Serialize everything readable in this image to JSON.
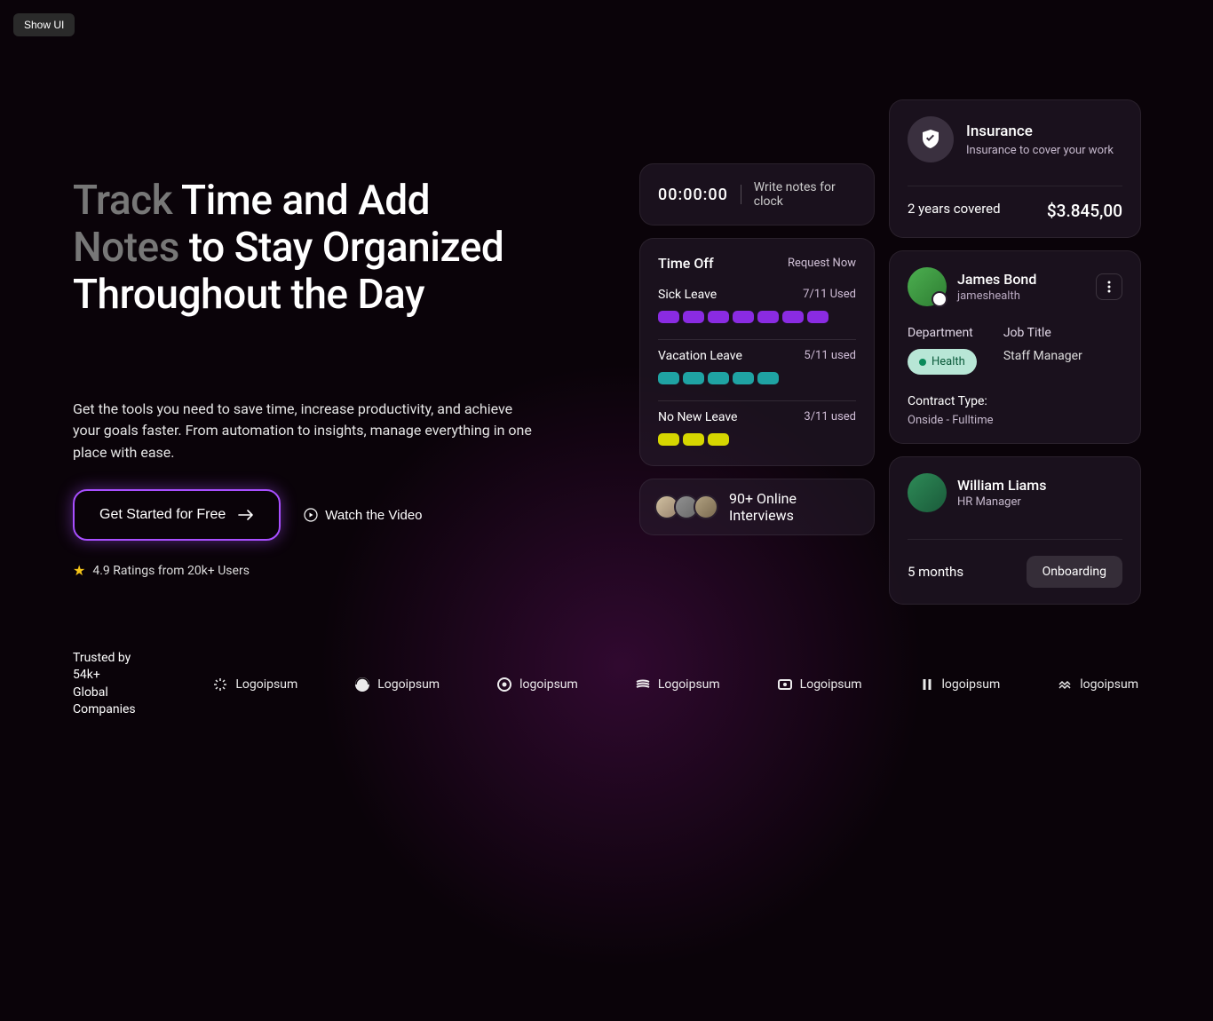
{
  "showUiLabel": "Show UI",
  "hero": {
    "titleDim1": "Track",
    "titlePart1": "Time and Add",
    "titleDim2": "Notes",
    "titlePart2": "to Stay Organized Throughout the Day",
    "subtitle": "Get the tools you need to save time, increase productivity, and achieve your goals faster. From automation to insights, manage everything in one place with ease.",
    "ctaPrimary": "Get Started for Free",
    "ctaSecondary": "Watch the Video",
    "rating": "4.9 Ratings from 20k+ Users"
  },
  "clock": {
    "time": "00:00:00",
    "placeholder": "Write notes for clock"
  },
  "timeoff": {
    "title": "Time Off",
    "request": "Request Now",
    "items": [
      {
        "label": "Sick Leave",
        "used": "7/11 Used",
        "fill": 7,
        "total": 7,
        "color": "purple"
      },
      {
        "label": "Vacation Leave",
        "used": "5/11 used",
        "fill": 5,
        "total": 5,
        "color": "teal"
      },
      {
        "label": "No New Leave",
        "used": "3/11 used",
        "fill": 3,
        "total": 3,
        "color": "yellow"
      }
    ]
  },
  "interviews": {
    "text": "90+ Online Interviews"
  },
  "insurance": {
    "title": "Insurance",
    "subtitle": "Insurance to cover your work",
    "covered": "2 years covered",
    "price": "$3.845,00"
  },
  "profile": {
    "name": "James Bond",
    "handle": "jameshealth",
    "deptLabel": "Department",
    "deptValue": "Health",
    "titleLabel": "Job Title",
    "titleValue": "Staff Manager",
    "contractLabel": "Contract Type:",
    "contractValue": "Onside - Fulltime"
  },
  "onboarding": {
    "name": "William Liams",
    "role": "HR Manager",
    "months": "5 months",
    "badge": "Onboarding"
  },
  "trusted": {
    "line1": "Trusted by 54k+",
    "line2": "Global Companies",
    "logos": [
      "Logoipsum",
      "Logoipsum",
      "logoipsum",
      "Logoipsum",
      "Logoipsum",
      "logoipsum",
      "logoipsum"
    ]
  }
}
